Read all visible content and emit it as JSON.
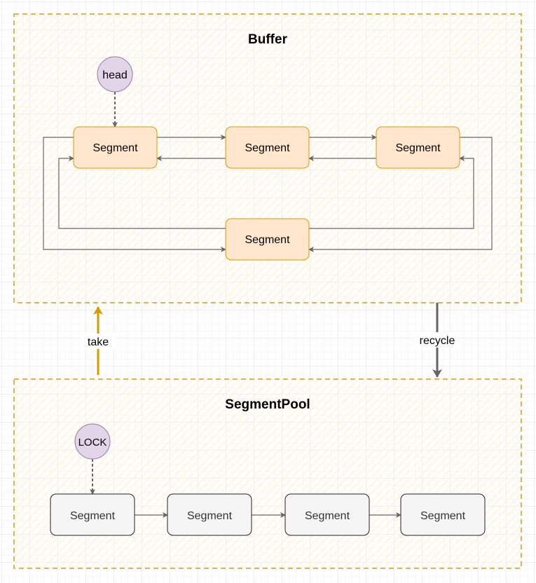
{
  "colors": {
    "container_border": "#d6b656",
    "container_hatch": "#fff2cc",
    "buffer_segment_fill": "#ffe6cc",
    "buffer_segment_stroke": "#d79b00",
    "pool_segment_fill": "#f5f5f5",
    "pool_segment_stroke": "#000000",
    "pointer_fill": "#e1d5e7",
    "pointer_stroke": "#9673a6",
    "take_arrow": "#d79b00",
    "connector": "#666666"
  },
  "buffer": {
    "title": "Buffer",
    "head_label": "head",
    "segments": [
      "Segment",
      "Segment",
      "Segment",
      "Segment"
    ]
  },
  "pool": {
    "title": "SegmentPool",
    "lock_label": "LOCK",
    "segments": [
      "Segment",
      "Segment",
      "Segment",
      "Segment"
    ]
  },
  "edges": {
    "take_label": "take",
    "recycle_label": "recycle"
  }
}
